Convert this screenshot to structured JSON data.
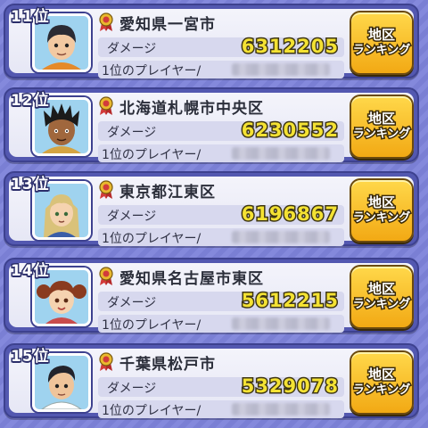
{
  "labels": {
    "damage": "ダメージ",
    "player": "1位のプレイヤー/",
    "button_line1": "地区",
    "button_line2": "ランキング"
  },
  "entries": [
    {
      "rank": "11位",
      "region": "愛知県一宮市",
      "damage": "6312205",
      "avatar": "boy-short-hair-icon",
      "avatar_hair": "#2b2b33",
      "avatar_shirt": "#e58a2a"
    },
    {
      "rank": "12位",
      "region": "北海道札幌市中央区",
      "damage": "6230552",
      "avatar": "dark-skin-spiky-hair-icon",
      "avatar_hair": "#1b1b1b",
      "avatar_shirt": "#d4a443"
    },
    {
      "rank": "13位",
      "region": "東京都江東区",
      "damage": "6196867",
      "avatar": "blonde-long-hair-icon",
      "avatar_hair": "#d9c27a",
      "avatar_shirt": "#3a5ea8"
    },
    {
      "rank": "14位",
      "region": "愛知県名古屋市東区",
      "damage": "5612215",
      "avatar": "girl-pigtails-icon",
      "avatar_hair": "#8a3b1f",
      "avatar_shirt": "#c94c4c"
    },
    {
      "rank": "15位",
      "region": "千葉県松戸市",
      "damage": "5329078",
      "avatar": "boy-side-part-icon",
      "avatar_hair": "#23232b",
      "avatar_shirt": "#ffffff"
    }
  ],
  "colors": {
    "background": "#7a7fd4",
    "row_border": "#3d418f",
    "damage_text": "#f4e233",
    "button": "#f2a914"
  }
}
